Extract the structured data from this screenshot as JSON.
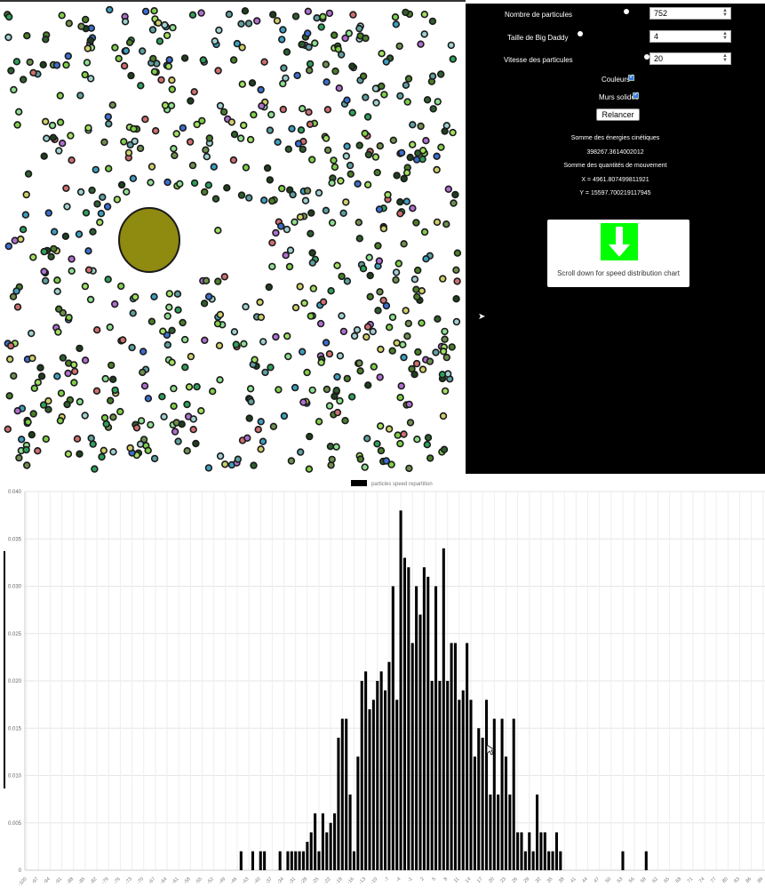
{
  "simulation": {
    "big_daddy": {
      "color": "#8f8a10"
    },
    "particle_count": 752
  },
  "controls": {
    "particles": {
      "label": "Nombre de particules",
      "value": "752"
    },
    "big_daddy": {
      "label": "Taille de Big Daddy",
      "value": "4"
    },
    "speed": {
      "label": "Vitesse des particules",
      "value": "20"
    },
    "colors": {
      "label": "Couleurs",
      "checked": true
    },
    "walls": {
      "label": "Murs solides",
      "checked": true
    },
    "restart_label": "Relancer"
  },
  "stats": {
    "kinetic_title": "Somme des énergies cinétiques",
    "kinetic_value": "398267.3614002012",
    "momentum_title": "Somme des quantités de mouvement",
    "momentum_x": "X = 4961.807499811921",
    "momentum_y": "Y = 15597.700219117945"
  },
  "scroll_hint": {
    "text": "Scroll down for speed distribution chart",
    "icon": "arrow-down-icon",
    "color": "#00ff00"
  },
  "chart_data": {
    "type": "bar",
    "legend": [
      "particles speed repartition"
    ],
    "legend_position": "top",
    "grid": true,
    "ylim": [
      0,
      0.04
    ],
    "y_ticks": [
      "0",
      "0.005",
      "0.010",
      "0.015",
      "0.020",
      "0.025",
      "0.030",
      "0.035",
      "0.040"
    ],
    "x_ticks": [
      "-100",
      "-97",
      "-94",
      "-91",
      "-88",
      "-85",
      "-82",
      "-79",
      "-76",
      "-73",
      "-70",
      "-67",
      "-64",
      "-61",
      "-58",
      "-55",
      "-52",
      "-49",
      "-46",
      "-43",
      "-40",
      "-37",
      "-34",
      "-31",
      "-28",
      "-25",
      "-22",
      "-19",
      "-16",
      "-13",
      "-10",
      "-7",
      "-4",
      "-1",
      "2",
      "5",
      "8",
      "11",
      "14",
      "17",
      "20",
      "23",
      "26",
      "29",
      "32",
      "35",
      "38",
      "41",
      "44",
      "47",
      "50",
      "53",
      "56",
      "59",
      "62",
      "65",
      "68",
      "71",
      "74",
      "77",
      "80",
      "83",
      "86",
      "89"
    ],
    "x_range": [
      -100,
      89
    ],
    "series": [
      {
        "name": "particles speed repartition",
        "color": "#000000",
        "x": [
          -45,
          -42,
          -40,
          -39,
          -35,
          -33,
          -32,
          -31,
          -30,
          -29,
          -28,
          -27,
          -26,
          -25,
          -24,
          -23,
          -22,
          -21,
          -20,
          -19,
          -18,
          -17,
          -16,
          -15,
          -14,
          -13,
          -12,
          -11,
          -10,
          -9,
          -8,
          -7,
          -6,
          -5,
          -4,
          -3,
          -2,
          -1,
          0,
          1,
          2,
          3,
          4,
          5,
          6,
          7,
          8,
          9,
          10,
          11,
          12,
          13,
          14,
          15,
          16,
          17,
          18,
          19,
          20,
          21,
          22,
          23,
          24,
          25,
          26,
          27,
          28,
          29,
          30,
          31,
          32,
          33,
          34,
          35,
          36,
          37,
          53,
          59
        ],
        "values": [
          0.002,
          0.002,
          0.002,
          0.002,
          0.002,
          0.002,
          0.002,
          0.002,
          0.002,
          0.002,
          0.003,
          0.004,
          0.006,
          0.002,
          0.006,
          0.004,
          0.005,
          0.006,
          0.014,
          0.016,
          0.016,
          0.008,
          0.002,
          0.012,
          0.02,
          0.021,
          0.017,
          0.018,
          0.02,
          0.021,
          0.019,
          0.022,
          0.03,
          0.018,
          0.038,
          0.033,
          0.032,
          0.024,
          0.03,
          0.027,
          0.032,
          0.031,
          0.02,
          0.03,
          0.02,
          0.034,
          0.02,
          0.024,
          0.024,
          0.018,
          0.019,
          0.024,
          0.018,
          0.012,
          0.015,
          0.014,
          0.018,
          0.008,
          0.016,
          0.008,
          0.016,
          0.012,
          0.008,
          0.016,
          0.004,
          0.004,
          0.002,
          0.004,
          0.002,
          0.008,
          0.004,
          0.004,
          0.002,
          0.002,
          0.004,
          0.002,
          0.002,
          0.002
        ]
      }
    ]
  }
}
